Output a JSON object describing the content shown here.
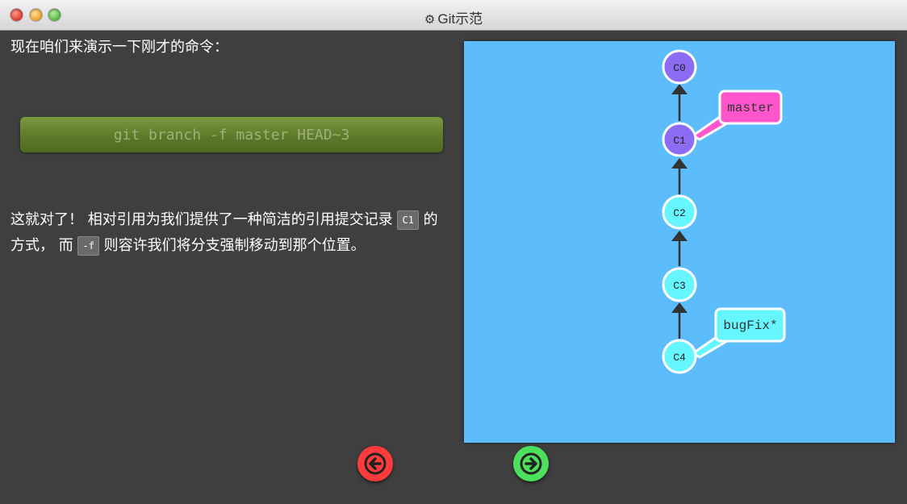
{
  "window": {
    "title": "Git示范",
    "title_icon": "gear-icon"
  },
  "lesson": {
    "intro": "现在咱们来演示一下刚才的命令：",
    "command": "git branch -f master HEAD~3",
    "explain_part1": "这就对了！ 相对引用为我们提供了一种简洁的引用提交记录",
    "explain_code1": "C1",
    "explain_part2": "的方式，  而",
    "explain_code2": "-f",
    "explain_part3": "则容许我们将分支强制移动到那个位置。"
  },
  "graph": {
    "commits": [
      "C0",
      "C1",
      "C2",
      "C3",
      "C4"
    ],
    "branches": [
      {
        "name": "master",
        "target": "C1",
        "color": "#ff55cc"
      },
      {
        "name": "bugFix*",
        "target": "C4",
        "color": "#66f6ff"
      }
    ],
    "colors": {
      "background": "#5cbcfc",
      "commit_master": "#8b6cf2",
      "commit_bugfix": "#66f6ff",
      "edge": "#333333"
    }
  },
  "navigation": {
    "back_icon": "arrow-left-icon",
    "forward_icon": "arrow-right-icon",
    "back_color": "#ff3b3b",
    "forward_color": "#4ce05c"
  }
}
